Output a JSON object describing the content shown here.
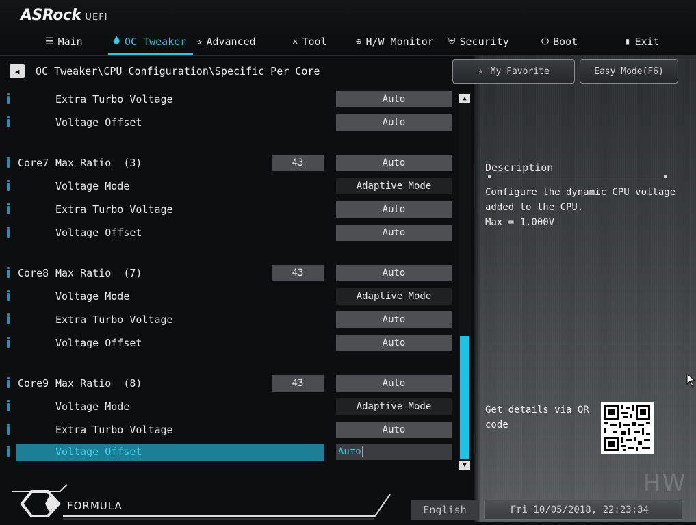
{
  "brand": {
    "name": "ASRock",
    "suffix": "UEFI"
  },
  "nav": [
    {
      "label": "Main",
      "icon": "list-icon"
    },
    {
      "label": "OC Tweaker",
      "icon": "flame-icon",
      "active": true
    },
    {
      "label": "Advanced",
      "icon": "star-icon"
    },
    {
      "label": "Tool",
      "icon": "tools-icon"
    },
    {
      "label": "H/W Monitor",
      "icon": "monitor-icon"
    },
    {
      "label": "Security",
      "icon": "shield-icon"
    },
    {
      "label": "Boot",
      "icon": "power-icon"
    },
    {
      "label": "Exit",
      "icon": "exit-icon"
    }
  ],
  "breadcrumb": "OC Tweaker\\CPU Configuration\\Specific Per Core",
  "buttons": {
    "favorite": "My Favorite",
    "easy_mode": "Easy Mode(F6)"
  },
  "settings": [
    {
      "label": "Extra Turbo Voltage",
      "value": "Auto"
    },
    {
      "label": "Voltage Offset",
      "value": "Auto"
    },
    {
      "core": "Core7",
      "label": "Max Ratio  (3)",
      "ratio": "43",
      "value": "Auto"
    },
    {
      "label": "Voltage Mode",
      "value": "Adaptive Mode"
    },
    {
      "label": "Extra Turbo Voltage",
      "value": "Auto"
    },
    {
      "label": "Voltage Offset",
      "value": "Auto"
    },
    {
      "core": "Core8",
      "label": "Max Ratio  (7)",
      "ratio": "43",
      "value": "Auto"
    },
    {
      "label": "Voltage Mode",
      "value": "Adaptive Mode"
    },
    {
      "label": "Extra Turbo Voltage",
      "value": "Auto"
    },
    {
      "label": "Voltage Offset",
      "value": "Auto"
    },
    {
      "core": "Core9",
      "label": "Max Ratio  (8)",
      "ratio": "43",
      "value": "Auto"
    },
    {
      "label": "Voltage Mode",
      "value": "Adaptive Mode"
    },
    {
      "label": "Extra Turbo Voltage",
      "value": "Auto"
    },
    {
      "label": "Voltage Offset",
      "value": "Auto",
      "selected": true
    }
  ],
  "description": {
    "title": "Description",
    "text": "Configure the dynamic CPU voltage\nadded to the CPU.\nMax = 1.000V"
  },
  "qr_text": "Get details via QR code",
  "footer": {
    "logo_text": "FORMULA",
    "language": "English",
    "datetime": "Fri 10/05/2018, 22:23:34",
    "watermark": "HW"
  },
  "colors": {
    "accent": "#2cc8e6",
    "selection": "#1d7f95"
  }
}
